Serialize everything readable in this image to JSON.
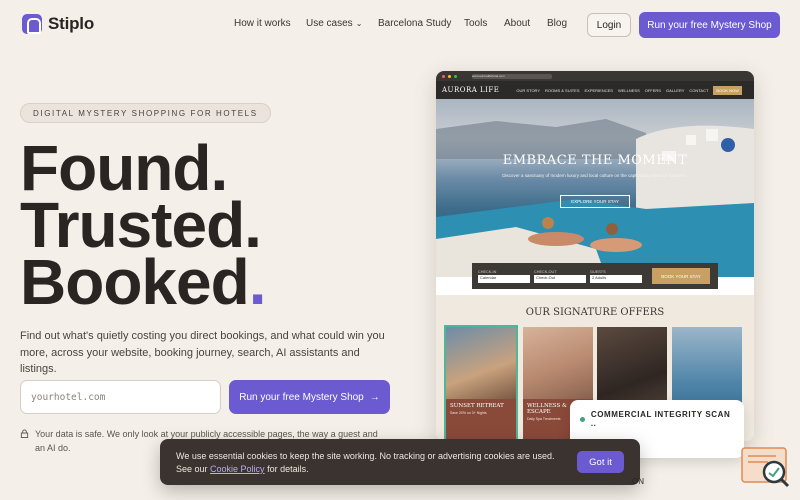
{
  "brand": {
    "name": "Stiplo",
    "accent": "#6c5ad0"
  },
  "nav": {
    "links": [
      "How it works",
      "Use cases",
      "Barcelona Study",
      "Tools",
      "About",
      "Blog"
    ],
    "login": "Login",
    "cta": "Run your free Mystery Shop"
  },
  "hero": {
    "eyebrow": "DIGITAL MYSTERY SHOPPING FOR HOTELS",
    "headline": [
      "Found.",
      "Trusted.",
      "Booked"
    ],
    "headline_dot": ".",
    "lede": "Find out what's quietly costing you direct bookings, and what could win you more, across your website, booking journey, search, AI assistants and listings.",
    "input_placeholder": "yourhotel.com",
    "cta": "Run your free Mystery Shop",
    "cta_arrow": "→",
    "note": "Your data is safe. We only look at your publicly accessible pages, the way a guest and an AI do."
  },
  "mock": {
    "url": "www.auroralifehotel.com",
    "site_name": "AURORA LIFE",
    "site_links": [
      "OUR STORY",
      "ROOMS & SUITES",
      "EXPERIENCES",
      "WELLNESS",
      "OFFERS",
      "GALLERY",
      "CONTACT"
    ],
    "book_now": "BOOK NOW",
    "hero_title": "EMBRACE THE MOMENT",
    "hero_sub": "Discover a sanctuary of modern luxury and local culture on the captivating island of Santorini.",
    "explore": "EXPLORE YOUR STAY",
    "booking": {
      "fields": [
        {
          "label": "CHECK-IN",
          "value": "Calendar"
        },
        {
          "label": "CHECK-OUT",
          "value": "Check-Out"
        },
        {
          "label": "GUESTS",
          "value": "2 Adults"
        }
      ],
      "button": "BOOK YOUR STAY"
    },
    "offers_title": "OUR SIGNATURE OFFERS",
    "offers": [
      {
        "name": "SUNSET RETREAT",
        "detail": "Save 20% on 3+ Nights"
      },
      {
        "name": "WELLNESS & ESCAPE",
        "detail": "Daily Spa Treatments"
      },
      {
        "name": "",
        "detail": ""
      },
      {
        "name": "",
        "detail": ""
      }
    ]
  },
  "scan": {
    "label": "COMMERCIAL INTEGRITY SCAN .."
  },
  "cookie": {
    "text_before": "We use essential cookies to keep the site working. No tracking or advertising cookies are used. See our ",
    "link": "Cookie Policy",
    "text_after": " for details.",
    "button": "Got it"
  },
  "peek_text": "ON"
}
